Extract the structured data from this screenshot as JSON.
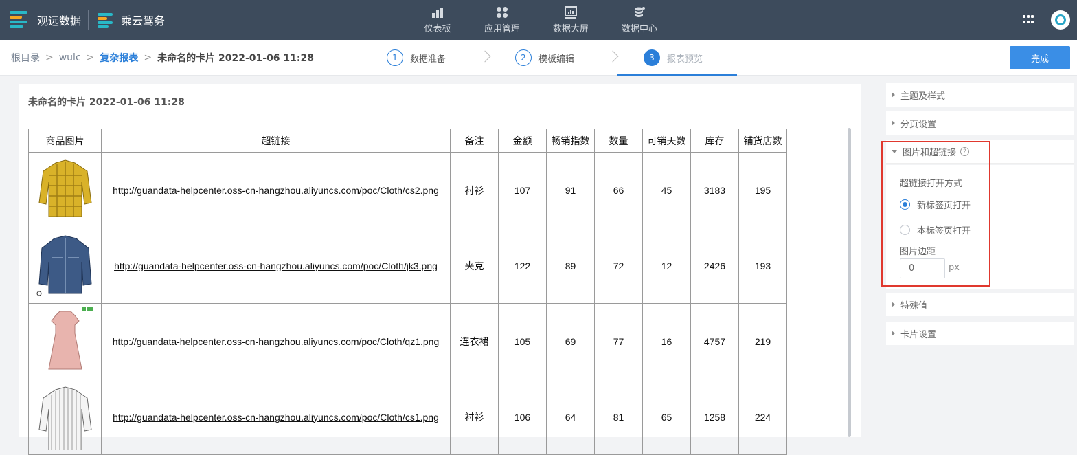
{
  "brand": {
    "primary": "观远数据",
    "secondary": "乘云驾务"
  },
  "nav": [
    {
      "label": "仪表板",
      "icon": "bar-chart-icon"
    },
    {
      "label": "应用管理",
      "icon": "apps-grid-icon"
    },
    {
      "label": "数据大屏",
      "icon": "screen-icon"
    },
    {
      "label": "数据中心",
      "icon": "database-icon"
    }
  ],
  "breadcrumb": {
    "root": "根目录",
    "folder": "wulc",
    "report": "复杂报表",
    "current": "未命名的卡片 2022-01-06 11:28",
    "sep": ">"
  },
  "steps": [
    {
      "num": "1",
      "label": "数据准备"
    },
    {
      "num": "2",
      "label": "模板编辑"
    },
    {
      "num": "3",
      "label": "报表预览"
    }
  ],
  "finish_label": "完成",
  "card_title": "未命名的卡片 2022-01-06 11:28",
  "table": {
    "headers": [
      "商品图片",
      "超链接",
      "备注",
      "金额",
      "畅销指数",
      "数量",
      "可销天数",
      "库存",
      "铺货店数"
    ],
    "rows": [
      {
        "link": "http://guandata-helpcenter.oss-cn-hangzhou.aliyuncs.com/poc/Cloth/cs2.png",
        "note": "衬衫",
        "amount": "107",
        "index": "91",
        "qty": "66",
        "days": "45",
        "stock": "3183",
        "stores": "195"
      },
      {
        "link": "http://guandata-helpcenter.oss-cn-hangzhou.aliyuncs.com/poc/Cloth/jk3.png",
        "note": "夹克",
        "amount": "122",
        "index": "89",
        "qty": "72",
        "days": "12",
        "stock": "2426",
        "stores": "193"
      },
      {
        "link": "http://guandata-helpcenter.oss-cn-hangzhou.aliyuncs.com/poc/Cloth/qz1.png",
        "note": "连衣裙",
        "amount": "105",
        "index": "69",
        "qty": "77",
        "days": "16",
        "stock": "4757",
        "stores": "219"
      },
      {
        "link": "http://guandata-helpcenter.oss-cn-hangzhou.aliyuncs.com/poc/Cloth/cs1.png",
        "note": "衬衫",
        "amount": "106",
        "index": "64",
        "qty": "81",
        "days": "65",
        "stock": "1258",
        "stores": "224"
      }
    ]
  },
  "panel": {
    "theme": "主题及样式",
    "paging": "分页设置",
    "image_link": "图片和超链接",
    "open_mode_label": "超链接打开方式",
    "open_new_tab": "新标签页打开",
    "open_same_tab": "本标签页打开",
    "image_padding_label": "图片边距",
    "image_padding_value": "0",
    "image_padding_unit": "px",
    "special": "特殊值",
    "card_settings": "卡片设置"
  },
  "colors": {
    "topbar": "#3d4b5c",
    "accent": "#2b7fd9",
    "highlight": "#e0382e"
  }
}
